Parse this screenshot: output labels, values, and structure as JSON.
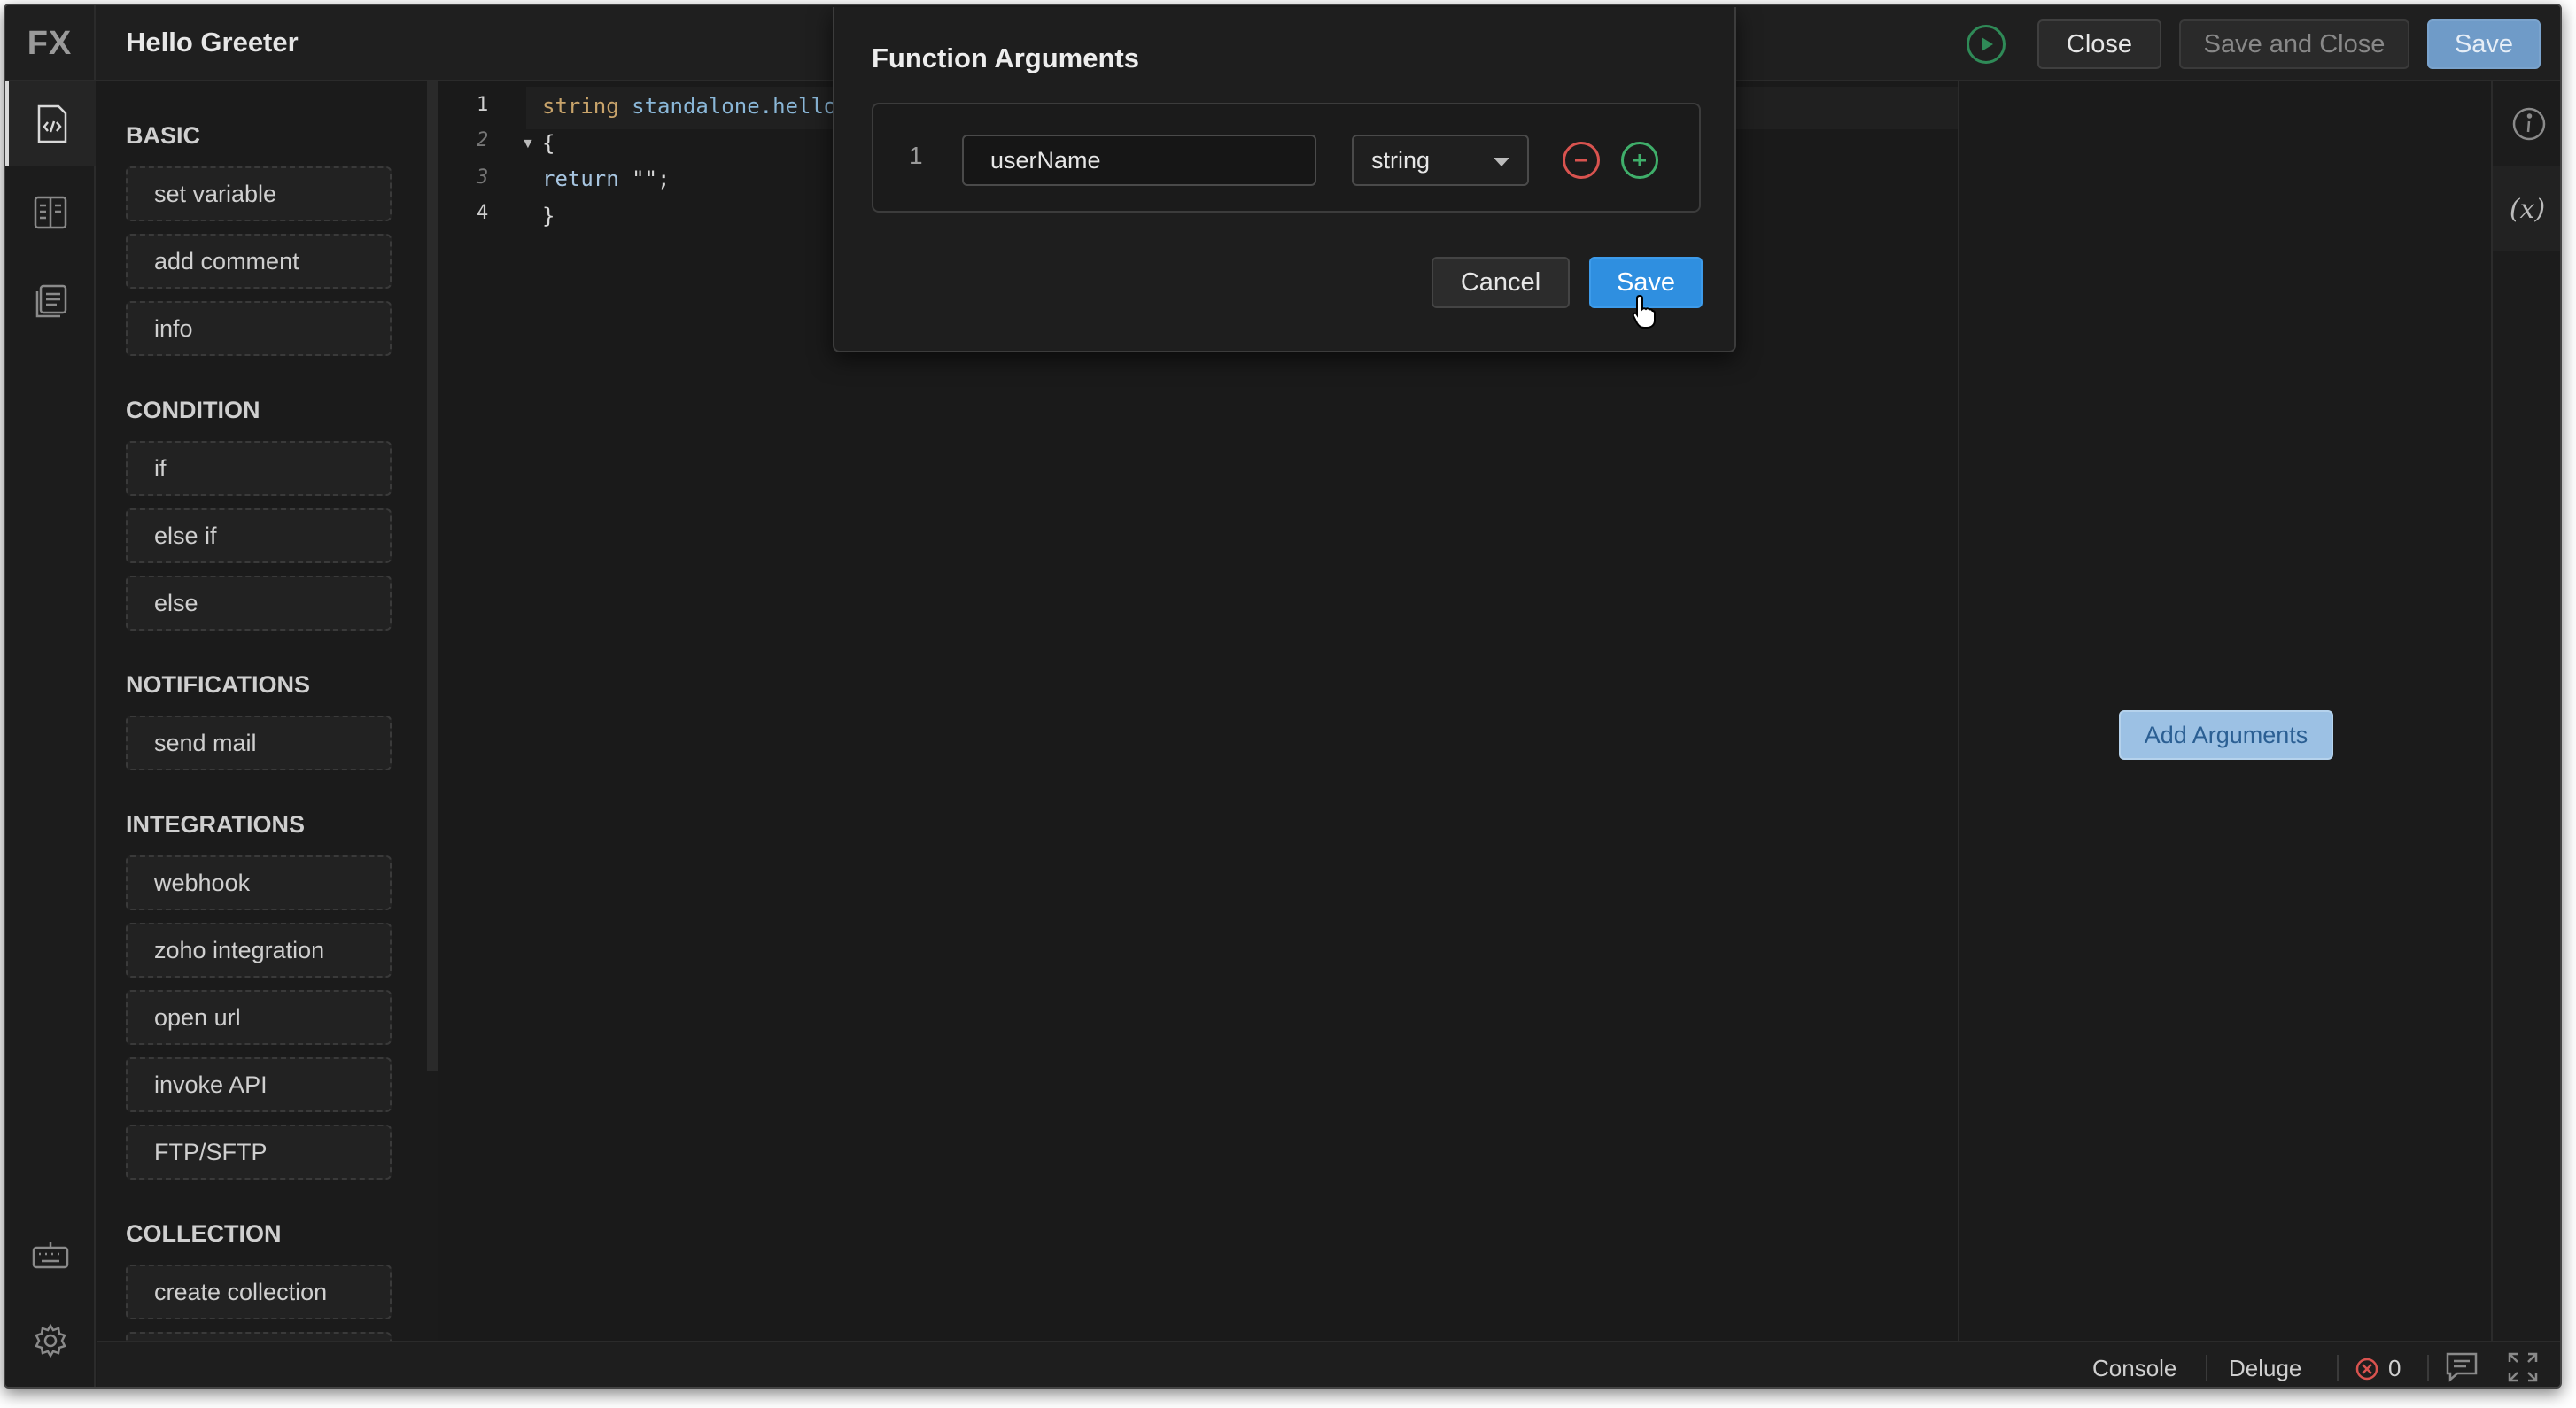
{
  "header": {
    "logo": "FX",
    "title": "Hello Greeter",
    "close_label": "Close",
    "save_close_label": "Save and Close",
    "save_label": "Save"
  },
  "rail": {
    "icons": [
      "code-editor-icon",
      "split-view-icon",
      "documents-icon",
      "keyboard-icon",
      "settings-icon"
    ]
  },
  "palette": {
    "sections": [
      {
        "title": "BASIC",
        "items": [
          "set variable",
          "add comment",
          "info"
        ]
      },
      {
        "title": "CONDITION",
        "items": [
          "if",
          "else if",
          "else"
        ]
      },
      {
        "title": "NOTIFICATIONS",
        "items": [
          "send mail"
        ]
      },
      {
        "title": "INTEGRATIONS",
        "items": [
          "webhook",
          "zoho integration",
          "open url",
          "invoke API",
          "FTP/SFTP"
        ]
      },
      {
        "title": "COLLECTION",
        "items": [
          "create collection"
        ]
      }
    ]
  },
  "editor": {
    "line_numbers": [
      "1",
      "2",
      "3",
      "4"
    ],
    "lines": {
      "l1_type": "string",
      "l1_name": " standalone.hello",
      "l2": "{",
      "l3_kw": "return",
      "l3_rest": " \"\";",
      "l4": "}"
    }
  },
  "right_panel": {
    "add_arguments_label": "Add Arguments",
    "icons": [
      "info-icon",
      "variable-icon"
    ]
  },
  "statusbar": {
    "console_label": "Console",
    "language_label": "Deluge",
    "error_count": "0"
  },
  "modal": {
    "title": "Function Arguments",
    "arguments": [
      {
        "index": "1",
        "name": "userName",
        "type": "string"
      }
    ],
    "cancel_label": "Cancel",
    "save_label": "Save"
  },
  "colors": {
    "accent": "#2f8fe0",
    "run_green": "#2f8a57",
    "remove_red": "#d9534f",
    "add_green": "#3fae6a"
  }
}
